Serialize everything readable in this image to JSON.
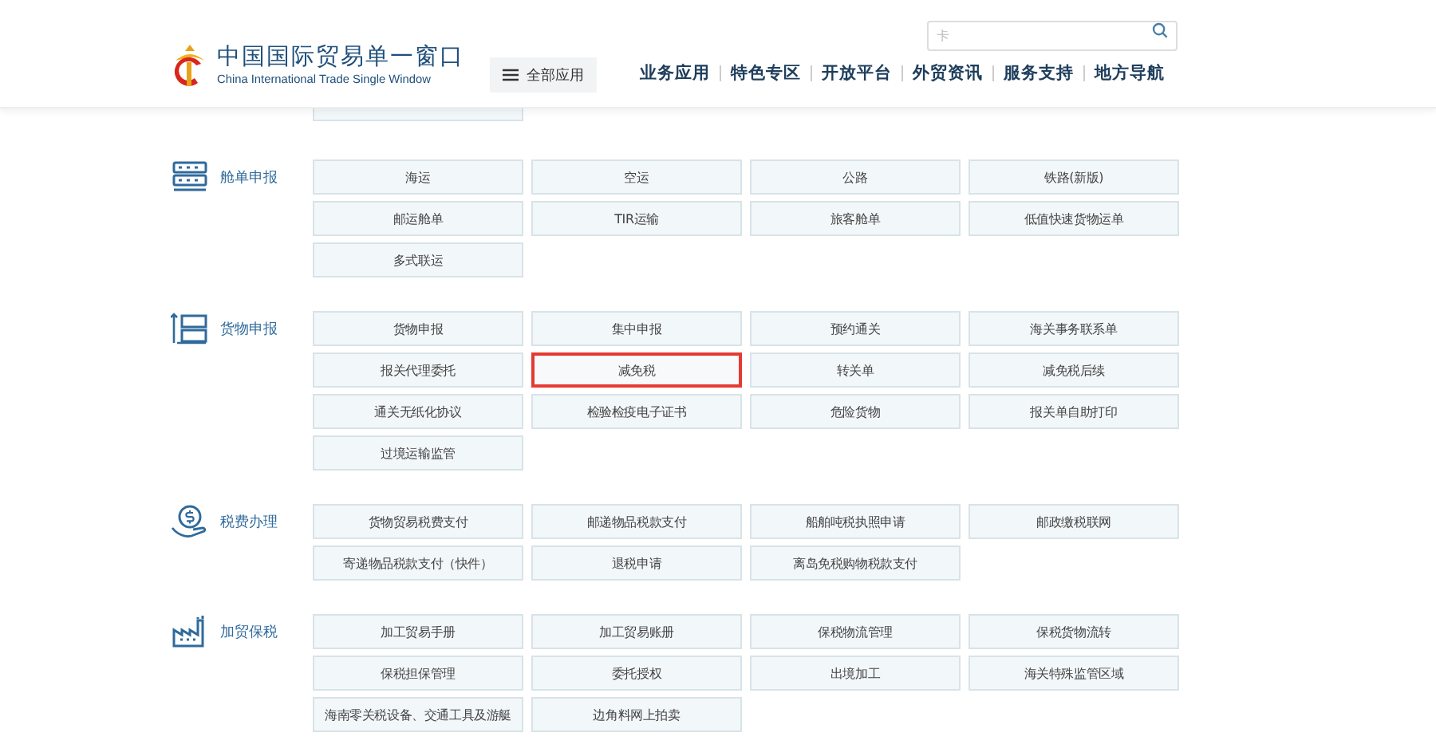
{
  "header": {
    "title": "中国国际贸易单一窗口",
    "subtitle": "China International Trade Single Window",
    "all_apps": "全部应用",
    "search": {
      "value": "卡"
    },
    "nav": [
      "业务应用",
      "特色专区",
      "开放平台",
      "外贸资讯",
      "服务支持",
      "地方导航"
    ]
  },
  "sections": [
    {
      "kind": "ship",
      "label": "舱单申报",
      "items": [
        {
          "label": "海运",
          "highlighted": false
        },
        {
          "label": "空运",
          "highlighted": false
        },
        {
          "label": "公路",
          "highlighted": false
        },
        {
          "label": "铁路(新版)",
          "highlighted": false
        },
        {
          "label": "邮运舱单",
          "highlighted": false
        },
        {
          "label": "TIR运输",
          "highlighted": false
        },
        {
          "label": "旅客舱单",
          "highlighted": false
        },
        {
          "label": "低值快速货物运单",
          "highlighted": false
        },
        {
          "label": "多式联运",
          "highlighted": false
        }
      ]
    },
    {
      "kind": "cargo",
      "label": "货物申报",
      "items": [
        {
          "label": "货物申报",
          "highlighted": false
        },
        {
          "label": "集中申报",
          "highlighted": false
        },
        {
          "label": "预约通关",
          "highlighted": false
        },
        {
          "label": "海关事务联系单",
          "highlighted": false
        },
        {
          "label": "报关代理委托",
          "highlighted": false
        },
        {
          "label": "减免税",
          "highlighted": true
        },
        {
          "label": "转关单",
          "highlighted": false
        },
        {
          "label": "减免税后续",
          "highlighted": false
        },
        {
          "label": "通关无纸化协议",
          "highlighted": false
        },
        {
          "label": "检验检疫电子证书",
          "highlighted": false
        },
        {
          "label": "危险货物",
          "highlighted": false
        },
        {
          "label": "报关单自助打印",
          "highlighted": false
        },
        {
          "label": "过境运输监管",
          "highlighted": false
        }
      ]
    },
    {
      "kind": "tax",
      "label": "税费办理",
      "items": [
        {
          "label": "货物贸易税费支付",
          "highlighted": false
        },
        {
          "label": "邮递物品税款支付",
          "highlighted": false
        },
        {
          "label": "船舶吨税执照申请",
          "highlighted": false
        },
        {
          "label": "邮政缴税联网",
          "highlighted": false
        },
        {
          "label": "寄递物品税款支付（快件）",
          "highlighted": false
        },
        {
          "label": "退税申请",
          "highlighted": false
        },
        {
          "label": "离岛免税购物税款支付",
          "highlighted": false
        }
      ]
    },
    {
      "kind": "factory",
      "label": "加贸保税",
      "items": [
        {
          "label": "加工贸易手册",
          "highlighted": false
        },
        {
          "label": "加工贸易账册",
          "highlighted": false
        },
        {
          "label": "保税物流管理",
          "highlighted": false
        },
        {
          "label": "保税货物流转",
          "highlighted": false
        },
        {
          "label": "保税担保管理",
          "highlighted": false
        },
        {
          "label": "委托授权",
          "highlighted": false
        },
        {
          "label": "出境加工",
          "highlighted": false
        },
        {
          "label": "海关特殊监管区域",
          "highlighted": false
        },
        {
          "label": "海南零关税设备、交通工具及游艇",
          "highlighted": false
        },
        {
          "label": "边角料网上拍卖",
          "highlighted": false
        }
      ]
    }
  ]
}
